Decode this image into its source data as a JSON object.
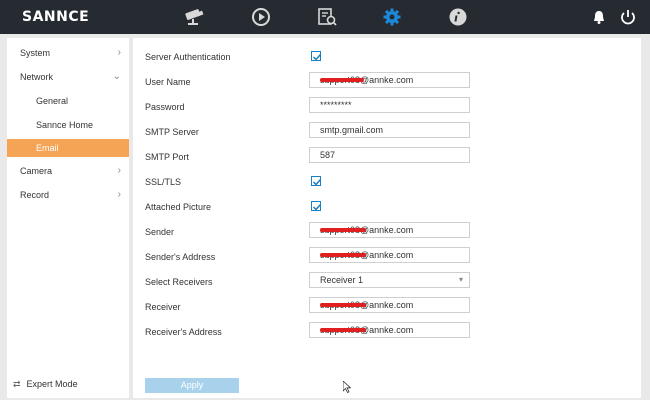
{
  "app": {
    "logo": "SANNCE"
  },
  "topbar": {
    "icons": [
      "camera-icon",
      "playback-icon",
      "search-files-icon",
      "settings-icon",
      "info-icon",
      "bell-icon",
      "power-icon"
    ]
  },
  "sidebar": {
    "items": [
      {
        "label": "System"
      },
      {
        "label": "Network"
      },
      {
        "label": "General"
      },
      {
        "label": "Sannce Home"
      },
      {
        "label": "Email"
      },
      {
        "label": "Camera"
      },
      {
        "label": "Record"
      }
    ],
    "expert_mode": "Expert Mode"
  },
  "form": {
    "server_auth": {
      "label": "Server Authentication",
      "checked": true
    },
    "user_name": {
      "label": "User Name",
      "value": "support08@annke.com"
    },
    "password": {
      "label": "Password",
      "value": "*********"
    },
    "smtp_server": {
      "label": "SMTP Server",
      "value": "smtp.gmail.com"
    },
    "smtp_port": {
      "label": "SMTP Port",
      "value": "587"
    },
    "ssl_tls": {
      "label": "SSL/TLS",
      "checked": true
    },
    "attached_picture": {
      "label": "Attached Picture",
      "checked": true
    },
    "sender": {
      "label": "Sender",
      "value": "support08@annke.com"
    },
    "senders_address": {
      "label": "Sender's Address",
      "value": "support08@annke.com"
    },
    "select_receivers": {
      "label": "Select Receivers",
      "value": "Receiver 1"
    },
    "receiver": {
      "label": "Receiver",
      "value": "support08@annke.com"
    },
    "receivers_address": {
      "label": "Receiver's Address",
      "value": "support08@annke.com"
    },
    "apply_label": "Apply"
  },
  "colors": {
    "topbar": "#262b31",
    "accent": "#f5a455",
    "active_icon": "#1e88d8",
    "apply": "#a8d2ec",
    "redaction": "#e02020"
  }
}
